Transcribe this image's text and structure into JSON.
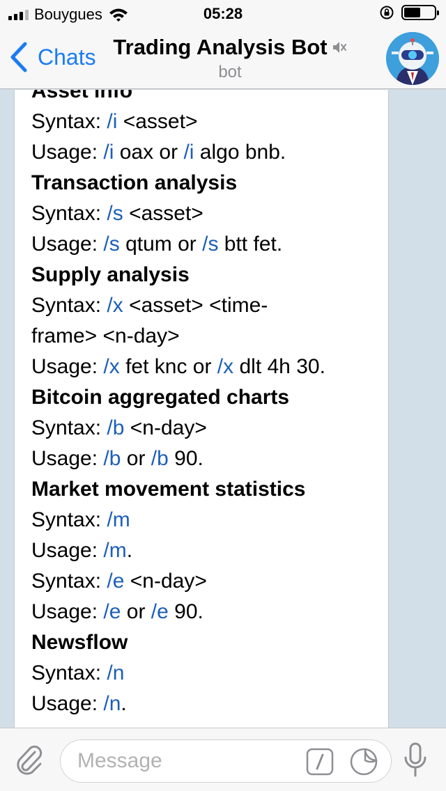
{
  "status_bar": {
    "carrier": "Bouygues",
    "time": "05:28"
  },
  "nav": {
    "back_label": "Chats",
    "title": "Trading Analysis Bot",
    "subtitle": "bot"
  },
  "message": {
    "lines": [
      {
        "type": "heading",
        "text": "Asset info"
      },
      {
        "type": "text",
        "parts": [
          {
            "t": "Syntax: "
          },
          {
            "t": "/i",
            "cmd": true
          },
          {
            "t": " <asset>"
          }
        ]
      },
      {
        "type": "text",
        "parts": [
          {
            "t": "Usage: "
          },
          {
            "t": "/i",
            "cmd": true
          },
          {
            "t": " oax or "
          },
          {
            "t": "/i",
            "cmd": true
          },
          {
            "t": " algo bnb."
          }
        ]
      },
      {
        "type": "heading",
        "text": "Transaction analysis"
      },
      {
        "type": "text",
        "parts": [
          {
            "t": "Syntax: "
          },
          {
            "t": "/s",
            "cmd": true
          },
          {
            "t": " <asset>"
          }
        ]
      },
      {
        "type": "text",
        "parts": [
          {
            "t": "Usage: "
          },
          {
            "t": "/s",
            "cmd": true
          },
          {
            "t": " qtum or "
          },
          {
            "t": "/s",
            "cmd": true
          },
          {
            "t": " btt fet."
          }
        ]
      },
      {
        "type": "heading",
        "text": "Supply analysis"
      },
      {
        "type": "text",
        "parts": [
          {
            "t": "Syntax: "
          },
          {
            "t": "/x",
            "cmd": true
          },
          {
            "t": " <asset> <time-"
          }
        ]
      },
      {
        "type": "text",
        "parts": [
          {
            "t": "frame> <n-day>"
          }
        ]
      },
      {
        "type": "text",
        "parts": [
          {
            "t": "Usage: "
          },
          {
            "t": "/x",
            "cmd": true
          },
          {
            "t": " fet knc or "
          },
          {
            "t": "/x",
            "cmd": true
          },
          {
            "t": " dlt 4h 30."
          }
        ]
      },
      {
        "type": "heading",
        "text": "Bitcoin aggregated charts"
      },
      {
        "type": "text",
        "parts": [
          {
            "t": "Syntax: "
          },
          {
            "t": "/b",
            "cmd": true
          },
          {
            "t": " <n-day>"
          }
        ]
      },
      {
        "type": "text",
        "parts": [
          {
            "t": "Usage: "
          },
          {
            "t": "/b",
            "cmd": true
          },
          {
            "t": " or "
          },
          {
            "t": "/b",
            "cmd": true
          },
          {
            "t": " 90."
          }
        ]
      },
      {
        "type": "heading",
        "text": "Market movement statistics"
      },
      {
        "type": "text",
        "parts": [
          {
            "t": "Syntax: "
          },
          {
            "t": "/m",
            "cmd": true
          }
        ]
      },
      {
        "type": "text",
        "parts": [
          {
            "t": "Usage: "
          },
          {
            "t": "/m",
            "cmd": true
          },
          {
            "t": "."
          }
        ]
      },
      {
        "type": "text",
        "parts": [
          {
            "t": "Syntax: "
          },
          {
            "t": "/e",
            "cmd": true
          },
          {
            "t": " <n-day>"
          }
        ]
      },
      {
        "type": "text",
        "parts": [
          {
            "t": "Usage: "
          },
          {
            "t": "/e",
            "cmd": true
          },
          {
            "t": " or "
          },
          {
            "t": "/e",
            "cmd": true
          },
          {
            "t": " 90."
          }
        ]
      },
      {
        "type": "heading",
        "text": "Newsflow"
      },
      {
        "type": "text",
        "parts": [
          {
            "t": "Syntax: "
          },
          {
            "t": "/n",
            "cmd": true
          }
        ]
      },
      {
        "type": "text",
        "parts": [
          {
            "t": "Usage: "
          },
          {
            "t": "/n",
            "cmd": true
          },
          {
            "t": "."
          }
        ]
      }
    ]
  },
  "input": {
    "placeholder": "Message"
  },
  "icons": {
    "back": "chevron-left-icon",
    "mute": "muted-speaker-icon",
    "attach": "paperclip-icon",
    "commands": "slash-command-icon",
    "sticker": "sticker-icon",
    "mic": "microphone-icon",
    "scroll_down": "chevron-down-icon"
  },
  "colors": {
    "accent": "#1b7cf3",
    "command_link": "#1c5fb8",
    "chat_background": "#d2dfe9"
  }
}
